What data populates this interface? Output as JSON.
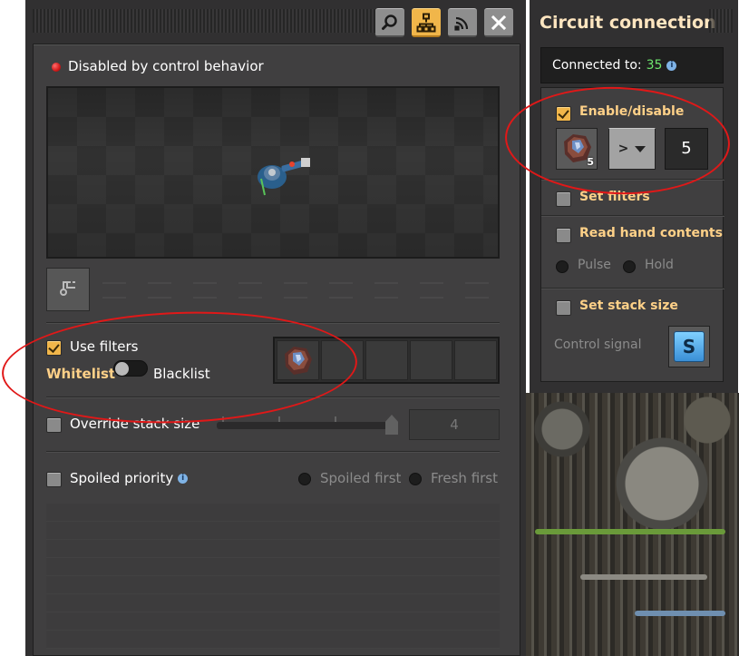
{
  "main_window": {
    "toolbar": {
      "buttons": [
        {
          "icon": "magnifier-icon",
          "active": false
        },
        {
          "icon": "circuit-network-icon",
          "active": true
        },
        {
          "icon": "wireless-signal-icon",
          "active": false
        },
        {
          "icon": "close-icon",
          "active": false
        }
      ]
    },
    "status": {
      "text": "Disabled by control behavior",
      "color": "#d21818"
    },
    "use_filters": {
      "label": "Use filters",
      "checked": true
    },
    "filter_mode": {
      "left_label": "Whitelist",
      "right_label": "Blacklist",
      "selected": "Whitelist"
    },
    "override_stack": {
      "label": "Override stack size",
      "checked": false,
      "value": "4"
    },
    "spoiled_priority": {
      "label": "Spoiled priority",
      "checked": false,
      "options": [
        "Spoiled first",
        "Fresh first"
      ]
    }
  },
  "circuit_window": {
    "title": "Circuit connection",
    "connected_label": "Connected to:",
    "connected_value": "35",
    "enable_disable": {
      "label": "Enable/disable",
      "checked": true,
      "signal_count": "5",
      "comparator": ">",
      "constant": "5"
    },
    "set_filters": {
      "label": "Set filters",
      "checked": false
    },
    "read_hand": {
      "label": "Read hand contents",
      "checked": false,
      "modes": [
        "Pulse",
        "Hold"
      ]
    },
    "set_stack_size": {
      "label": "Set stack size",
      "checked": false,
      "control_signal_label": "Control signal",
      "signal": "S"
    }
  },
  "colors": {
    "accent": "#f1b64a",
    "heading": "#ffd188",
    "connected_count": "#6ee56e",
    "annotation": "#e01818"
  }
}
